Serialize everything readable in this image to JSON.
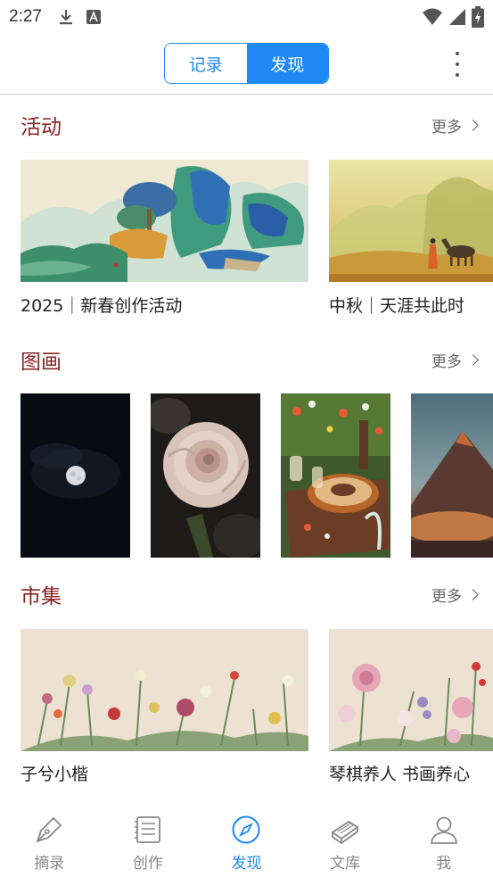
{
  "status_bar": {
    "time": "2:27",
    "icons": [
      "download-icon",
      "app-a-icon",
      "wifi-icon",
      "signal-icon",
      "battery-charging-icon"
    ]
  },
  "header": {
    "tabs": [
      {
        "label": "记录",
        "active": false
      },
      {
        "label": "发现",
        "active": true
      }
    ],
    "more_icon": "more-vertical-icon",
    "accent_color": "#1e88f5"
  },
  "sections": {
    "activities": {
      "title": "活动",
      "more": "更多",
      "cards": [
        {
          "caption": "2025｜新春创作活动",
          "image": "blue-green landscape painting"
        },
        {
          "caption": "中秋｜天涯共此时",
          "image": "golden mountains with horse"
        }
      ]
    },
    "paintings": {
      "title": "图画",
      "more": "更多",
      "cards": [
        {
          "image": "full moon at night"
        },
        {
          "image": "pale pink rose"
        },
        {
          "image": "table with cake and flowers"
        },
        {
          "image": "mountain at sunset"
        }
      ]
    },
    "market": {
      "title": "市集",
      "more": "更多",
      "cards": [
        {
          "caption": "子兮小楷",
          "image": "flower painting on beige"
        },
        {
          "caption": "琴棋养人 书画养心",
          "image": "peony painting on beige"
        }
      ]
    }
  },
  "section_title_color": "#8a2323",
  "bottom_nav": [
    {
      "label": "摘录",
      "icon": "pen-nib-icon",
      "active": false
    },
    {
      "label": "创作",
      "icon": "notebook-icon",
      "active": false
    },
    {
      "label": "发现",
      "icon": "compass-icon",
      "active": true
    },
    {
      "label": "文库",
      "icon": "books-icon",
      "active": false
    },
    {
      "label": "我",
      "icon": "person-icon",
      "active": false
    }
  ]
}
